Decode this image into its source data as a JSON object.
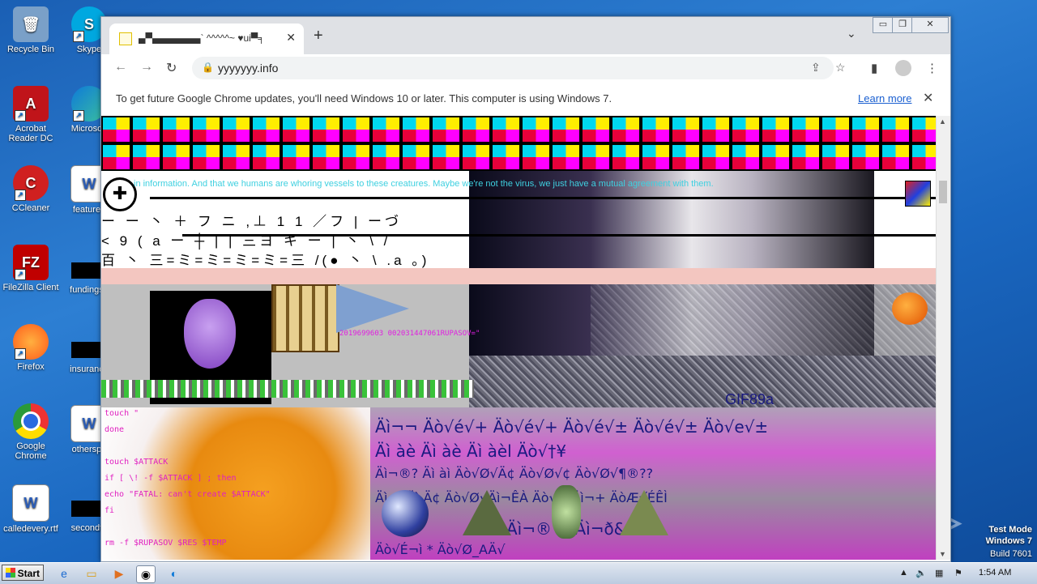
{
  "desktop": {
    "icons": [
      {
        "label": "Recycle Bin",
        "color": "#7aa0c8"
      },
      {
        "label": "Acrobat Reader DC",
        "color": "#c0141a"
      },
      {
        "label": "CCleaner",
        "color": "#d02020"
      },
      {
        "label": "FileZilla Client",
        "color": "#c00000"
      },
      {
        "label": "Firefox",
        "color": "#ff7a1a"
      },
      {
        "label": "Google Chrome",
        "color": "#2a8a3a"
      },
      {
        "label": "calledevery.rtf",
        "color": "#2b5db8"
      },
      {
        "label": "Skype",
        "color": "#00a8e0"
      },
      {
        "label": "Microsoft",
        "color": "#0e7ad8"
      },
      {
        "label": "featured",
        "color": "#2b5db8"
      },
      {
        "label": "fundingse",
        "color": "#000000"
      },
      {
        "label": "insurance",
        "color": "#000000"
      },
      {
        "label": "otherspo",
        "color": "#2b5db8"
      },
      {
        "label": "secondto",
        "color": "#000000"
      }
    ]
  },
  "browser": {
    "tab_title": "▄▀▄▄▄▄▄▄▄` ^^^^^~ ♥ui▀╕",
    "url": "yyyyyyy.info",
    "info_message": "To get future Google Chrome updates, you'll need Windows 10 or later. This computer is using Windows 7.",
    "learn_more": "Learn more",
    "window_controls": {
      "minimize": "▭",
      "maximize": "❐",
      "close": "✕"
    }
  },
  "page": {
    "cyan_text": "in information. And that we humans are whoring vessels to these creatures. Maybe we're not the virus, we just have a mutual agreement with them.",
    "glyph_row_1": "ー ー 丶 ＋ フ ニ ,⊥ 1 1 ／フ | ーづ",
    "glyph_row_2": "< 9 ( a ー ┼ | | 三ヨ キ ー | 丶 \\ /",
    "glyph_row_3": "百 丶 三=ミ=ミ=ミ=ミ=三 /(● 丶 \\ .a 。)",
    "magenta_code": "2019699603 002031447061RUPASOV=\"",
    "gif_label": "GIF89a",
    "glitch_lines": [
      "Äì¬¬ Äò√é√+ Äò√é√+ Äò√é√± Äò√é√± Äò√e√±",
      "Äì àè Äì àè Äì àèl Äò√†¥",
      "Äì¬®? Äì àì Äò√Ø√Ä¢ Äò√Ø√¢ Äò√Ø√¶®??",
      "Äì + Äì Ä¢ Äò√Ø√Äì¬ÊÀ Äò√Ø Äì¬+ ÄòÆ√ÉÊÌ",
      "Äì¬® Ø Äì¬ð& Äì√",
      "Äò√É¬ì * Äò√Ø_AÄ√"
    ],
    "terminal_lines": [
      "touch \"",
      "done",
      "touch $ATTACK",
      "if [ \\! -f $ATTACK ] ; then",
      "echo \"FATAL: can't create $ATTACK\"",
      "fi",
      "rm -f $RUPASOV $RES $TEMP"
    ]
  },
  "taskbar": {
    "start_label": "Start",
    "clock": "1:54 AM",
    "test_mode_1": "Test Mode",
    "test_mode_2": "Windows 7",
    "test_mode_3": "Build 7601",
    "watermark": "ANY ▷ RUN"
  }
}
